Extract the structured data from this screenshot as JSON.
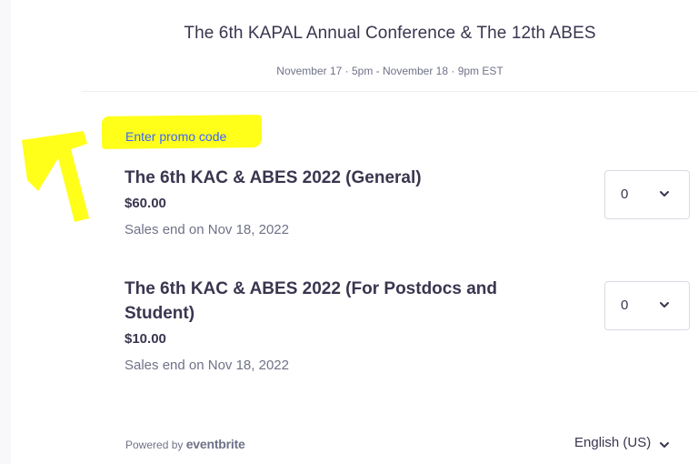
{
  "header": {
    "title": "The 6th KAPAL Annual Conference & The 12th ABES",
    "date_range": "November 17 · 5pm - November 18 · 9pm EST"
  },
  "promo": {
    "label": "Enter promo code",
    "highlight_color": "#ffff1a"
  },
  "tickets": [
    {
      "name": "The 6th KAC & ABES 2022 (General)",
      "price": "$60.00",
      "sales_end": "Sales end on Nov 18, 2022",
      "quantity": "0"
    },
    {
      "name": "The 6th KAC & ABES 2022 (For Postdocs and Student)",
      "price": "$10.00",
      "sales_end": "Sales end on Nov 18, 2022",
      "quantity": "0"
    }
  ],
  "footer": {
    "powered_by": "Powered by",
    "brand": "eventbrite",
    "language": "English (US)"
  },
  "icons": {
    "quantity_dropdown": "chevron-down-icon",
    "language_dropdown": "chevron-down-icon",
    "annotation": "arrow-icon"
  },
  "colors": {
    "link": "#3d64ff",
    "text": "#39364f",
    "muted": "#6f7287",
    "annotation": "#ffff1a"
  }
}
